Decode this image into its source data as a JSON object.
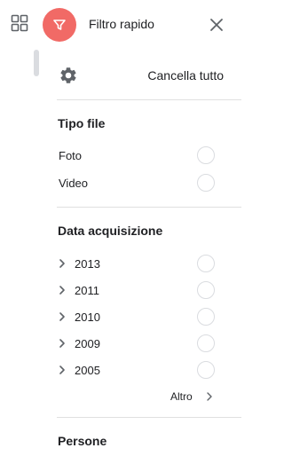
{
  "header": {
    "title": "Filtro rapido",
    "filter_icon": "filter-funnel-icon",
    "close_icon": "close-icon",
    "badge_color": "#f16a66"
  },
  "left_rail": {
    "grid_icon": "grid-view-icon"
  },
  "toolbar": {
    "settings_icon": "gear-icon",
    "clear_all_label": "Cancella tutto"
  },
  "sections": {
    "file_type": {
      "title": "Tipo file",
      "options": [
        {
          "label": "Foto",
          "selected": false
        },
        {
          "label": "Video",
          "selected": false
        }
      ]
    },
    "capture_date": {
      "title": "Data acquisizione",
      "options": [
        {
          "label": "2013",
          "selected": false
        },
        {
          "label": "2011",
          "selected": false
        },
        {
          "label": "2010",
          "selected": false
        },
        {
          "label": "2009",
          "selected": false
        },
        {
          "label": "2005",
          "selected": false
        }
      ],
      "more_label": "Altro"
    },
    "people": {
      "title": "Persone"
    }
  }
}
